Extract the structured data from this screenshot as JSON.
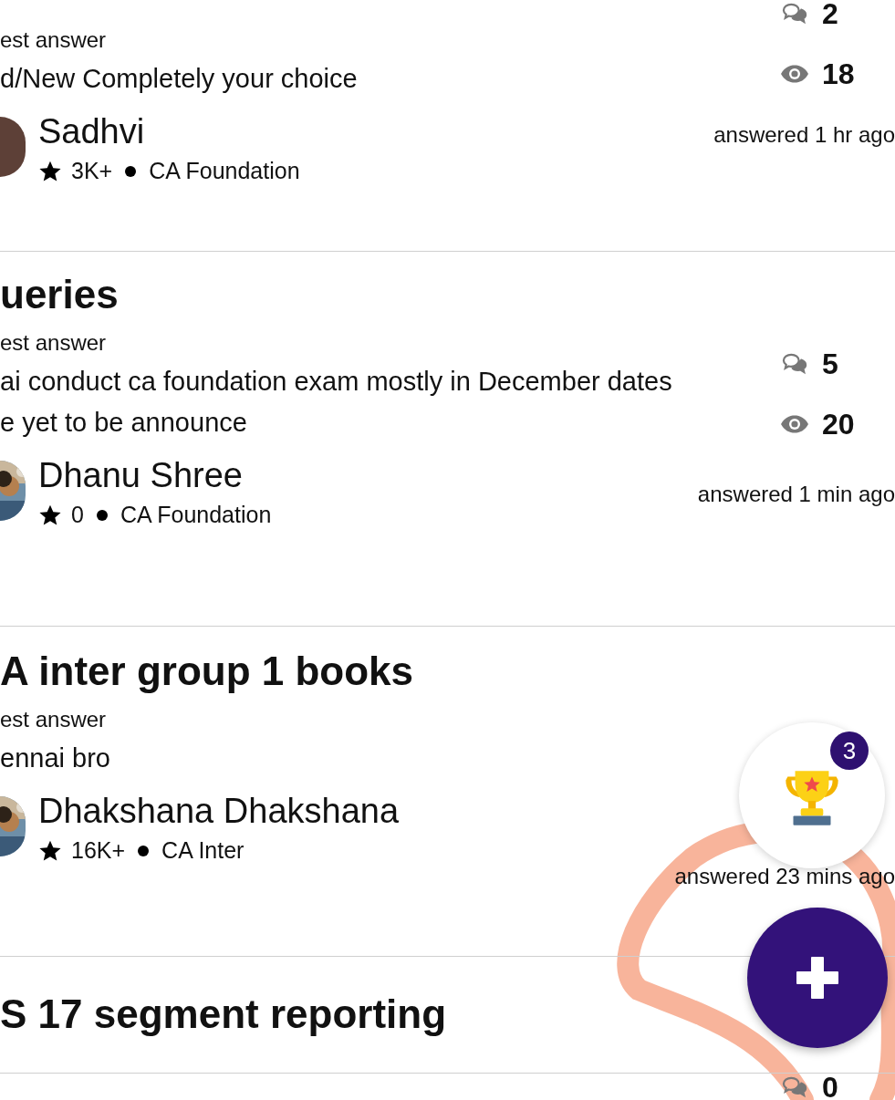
{
  "questions": [
    {
      "answer_label": "est answer",
      "answer_lines": [
        "d/New Completely your choice"
      ],
      "author": {
        "name": "Sadhvi",
        "rating": "3K+",
        "course": "CA Foundation",
        "avatar": {
          "kind": "letter",
          "color": "#5d4037"
        }
      },
      "comments": "2",
      "views": "18",
      "answered": "answered 1 hr ago"
    },
    {
      "title": "ueries",
      "answer_label": "est answer",
      "answer_lines": [
        "ai conduct ca foundation exam mostly in December dates",
        "e yet to be announce"
      ],
      "author": {
        "name": "Dhanu Shree",
        "rating": "0",
        "course": "CA Foundation"
      },
      "comments": "5",
      "views": "20",
      "answered": "answered 1 min ago"
    },
    {
      "title": "A inter group 1 books",
      "answer_label": "est answer",
      "answer_lines": [
        "ennai bro"
      ],
      "author": {
        "name": "Dhakshana Dhakshana",
        "rating": "16K+",
        "course": "CA Inter"
      },
      "answered": "answered 23 mins ago"
    },
    {
      "title": "S 17 segment reporting",
      "comments": "0"
    }
  ],
  "trophy_button": {
    "badge": "3"
  },
  "fab": {
    "kind": "add"
  },
  "annotation": {
    "kind": "scribble"
  }
}
